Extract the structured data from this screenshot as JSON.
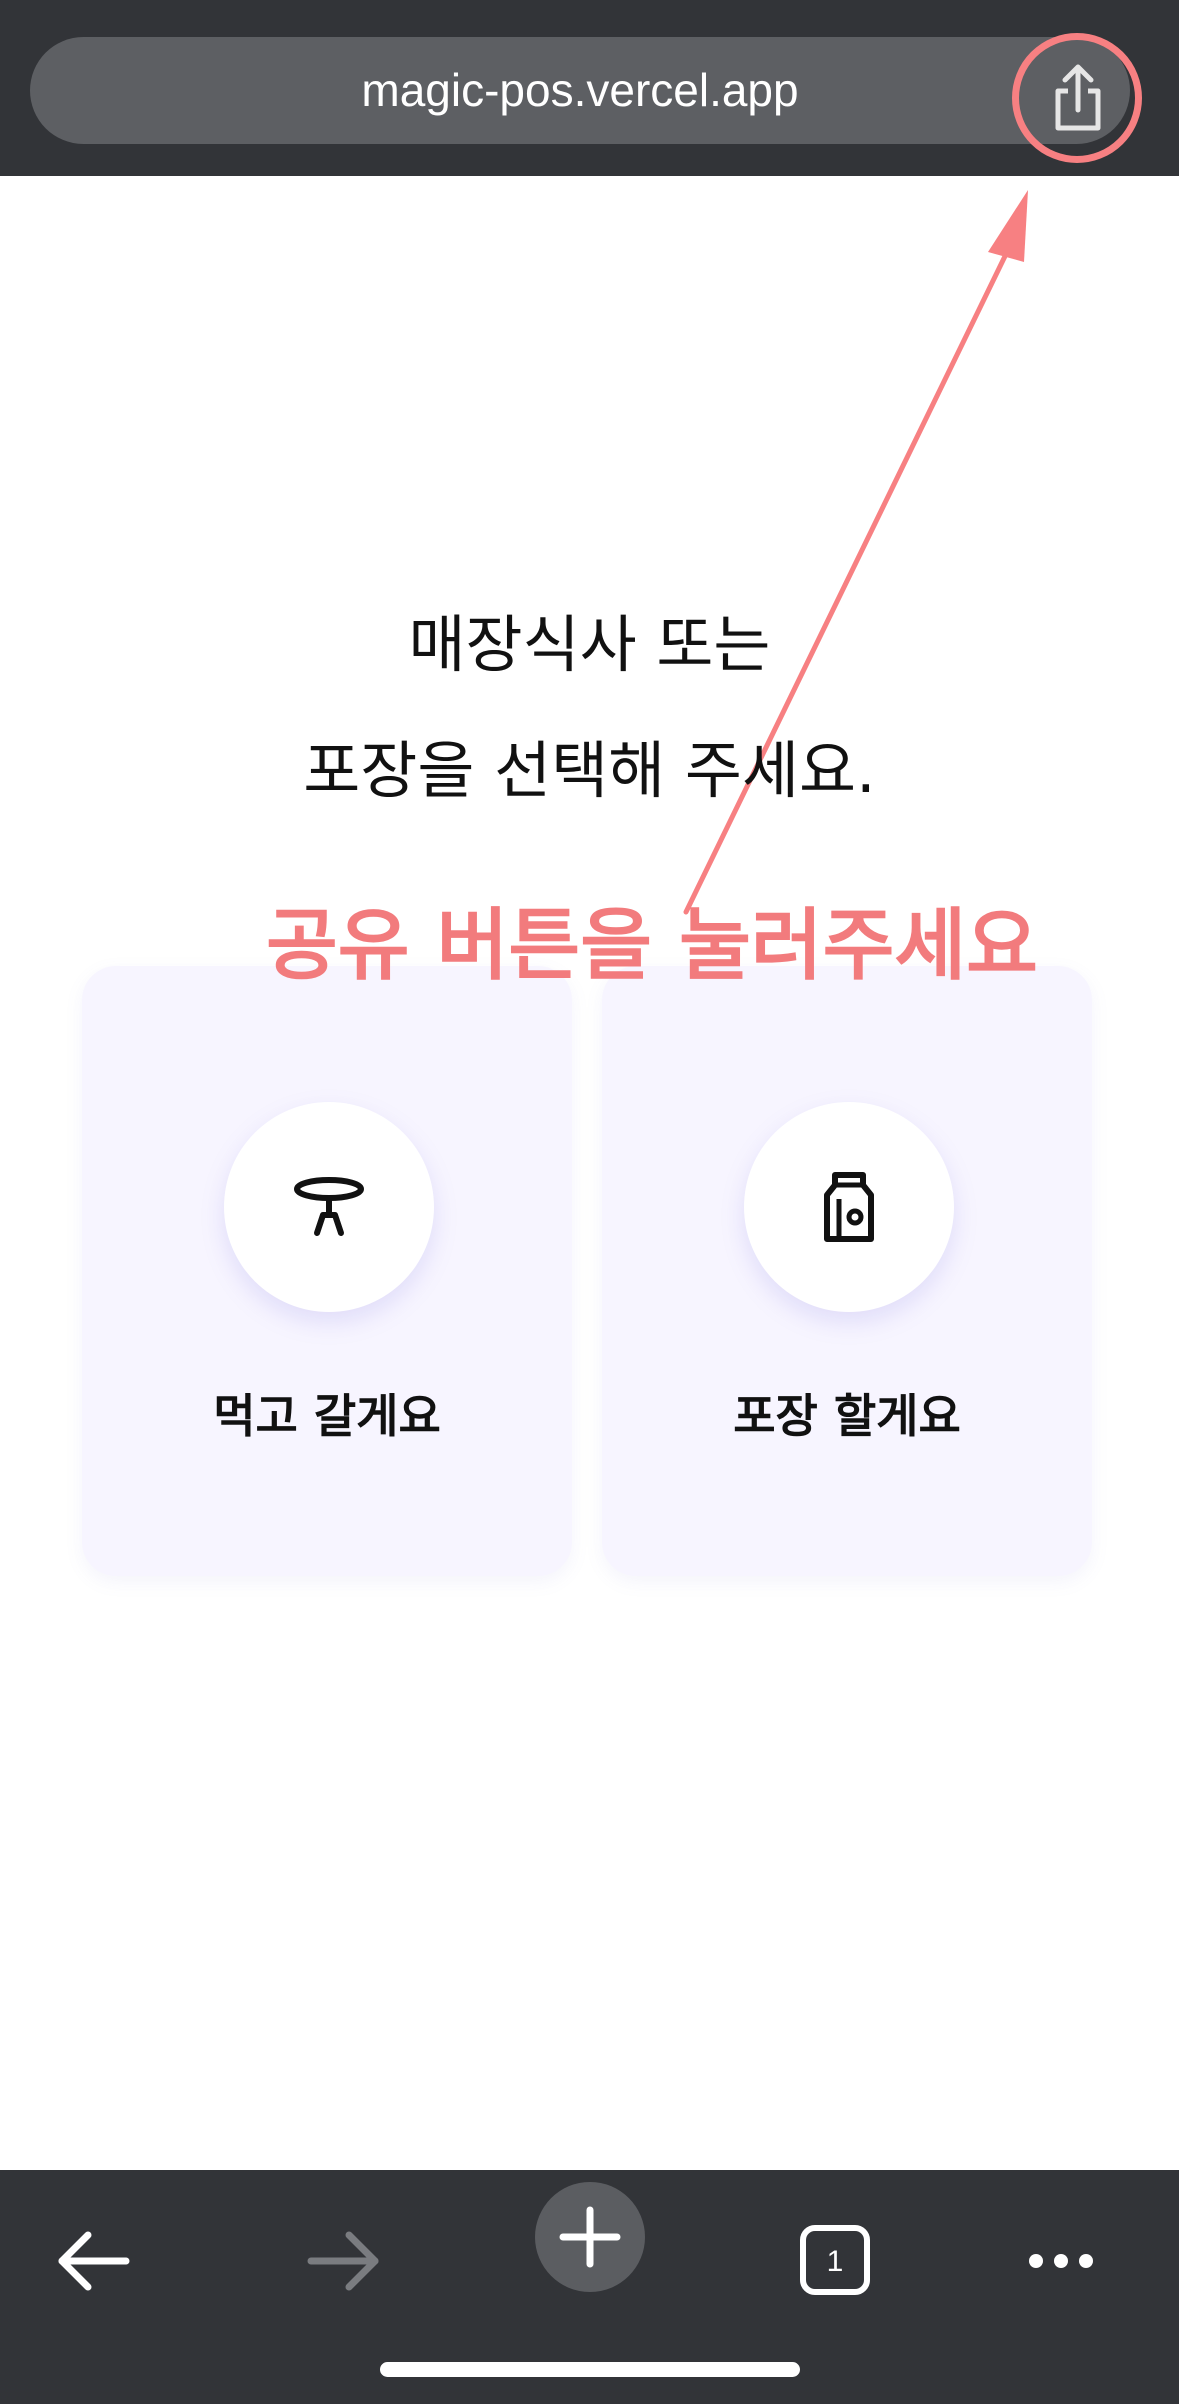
{
  "browser": {
    "url": "magic-pos.vercel.app",
    "share_icon": "share-icon",
    "tab_count": "1",
    "nav_icons": [
      "back-arrow-icon",
      "forward-arrow-icon",
      "plus-icon",
      "tabs-icon",
      "more-icon"
    ]
  },
  "page": {
    "headline_line1": "매장식사 또는",
    "headline_line2": "포장을 선택해 주세요.",
    "options": [
      {
        "label": "먹고 갈게요",
        "icon": "table-icon"
      },
      {
        "label": "포장 할게요",
        "icon": "bag-icon"
      }
    ]
  },
  "annotation": {
    "text": "공유 버튼을 눌러주세요",
    "color": "#f27b7d"
  },
  "colors": {
    "toolbar_bg": "#323438",
    "card_bg": "#f7f5ff",
    "accent": "#f78082"
  }
}
